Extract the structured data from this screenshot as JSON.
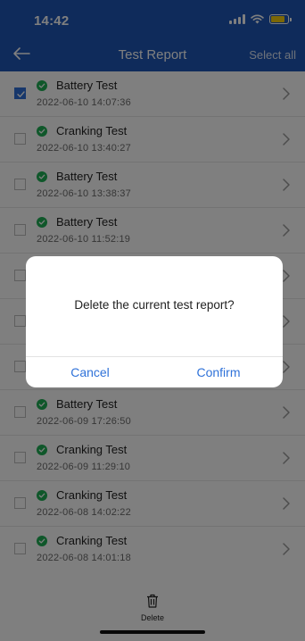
{
  "status_bar": {
    "time": "14:42"
  },
  "header": {
    "title": "Test Report",
    "select_all": "Select all"
  },
  "reports": [
    {
      "title": "Battery Test",
      "date": "2022-06-10 14:07:36",
      "checked": true
    },
    {
      "title": "Cranking Test",
      "date": "2022-06-10 13:40:27",
      "checked": false
    },
    {
      "title": "Battery Test",
      "date": "2022-06-10 13:38:37",
      "checked": false
    },
    {
      "title": "Battery Test",
      "date": "2022-06-10 11:52:19",
      "checked": false
    },
    {
      "title": "",
      "date": "",
      "checked": false
    },
    {
      "title": "",
      "date": "",
      "checked": false
    },
    {
      "title": "",
      "date": "",
      "checked": false
    },
    {
      "title": "Battery Test",
      "date": "2022-06-09 17:26:50",
      "checked": false
    },
    {
      "title": "Cranking Test",
      "date": "2022-06-09 11:29:10",
      "checked": false
    },
    {
      "title": "Cranking Test",
      "date": "2022-06-08 14:02:22",
      "checked": false
    },
    {
      "title": "Cranking Test",
      "date": "2022-06-08 14:01:18",
      "checked": false
    }
  ],
  "bottom_bar": {
    "delete_label": "Delete"
  },
  "dialog": {
    "message": "Delete the current test report?",
    "cancel": "Cancel",
    "confirm": "Confirm"
  },
  "colors": {
    "header": "#1f57b6",
    "accent": "#2f72d9",
    "success": "#1fae55",
    "battery": "#f6cf0f"
  }
}
